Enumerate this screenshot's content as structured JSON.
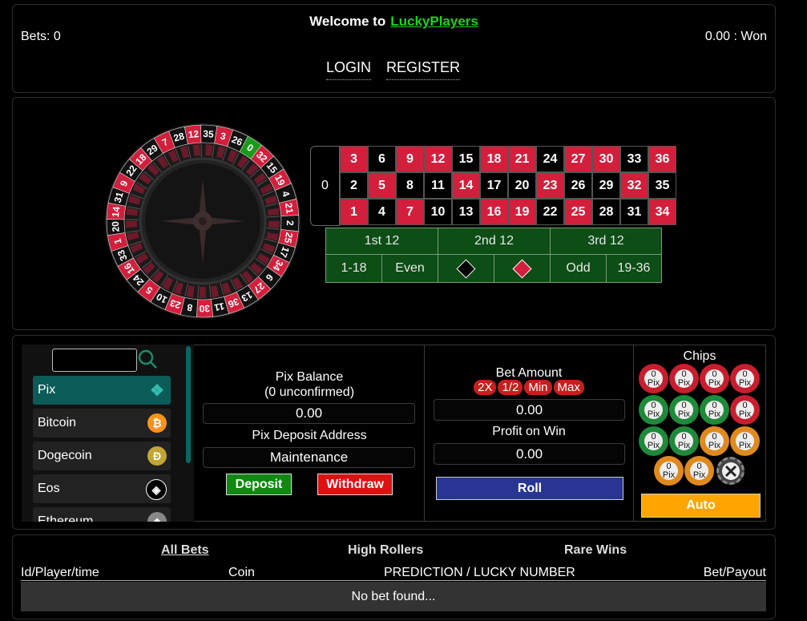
{
  "header": {
    "welcome": "Welcome to",
    "brand": "LuckyPlayers",
    "bets": "Bets: 0",
    "won": "0.00 : Won",
    "login": "LOGIN",
    "register": "REGISTER"
  },
  "table": {
    "zero": "0",
    "rows": [
      [
        "3",
        "6",
        "9",
        "12",
        "15",
        "18",
        "21",
        "24",
        "27",
        "30",
        "33",
        "36"
      ],
      [
        "2",
        "5",
        "8",
        "11",
        "14",
        "17",
        "20",
        "23",
        "26",
        "29",
        "32",
        "35"
      ],
      [
        "1",
        "4",
        "7",
        "10",
        "13",
        "16",
        "19",
        "22",
        "25",
        "28",
        "31",
        "34"
      ]
    ],
    "reds": [
      "1",
      "3",
      "5",
      "7",
      "9",
      "12",
      "14",
      "16",
      "18",
      "19",
      "21",
      "23",
      "25",
      "27",
      "30",
      "32",
      "34",
      "36"
    ],
    "dozens": [
      "1st 12",
      "2nd 12",
      "3rd 12"
    ],
    "outside": [
      "1-18",
      "Even",
      "",
      "",
      "Odd",
      "19-36"
    ]
  },
  "wheel": {
    "numbers": [
      "0",
      "32",
      "15",
      "19",
      "4",
      "21",
      "2",
      "25",
      "17",
      "34",
      "6",
      "27",
      "13",
      "36",
      "11",
      "30",
      "8",
      "23",
      "10",
      "5",
      "24",
      "16",
      "33",
      "1",
      "20",
      "14",
      "31",
      "9",
      "22",
      "18",
      "29",
      "7",
      "28",
      "12",
      "35",
      "3",
      "26"
    ]
  },
  "coins": {
    "search_value": "",
    "items": [
      {
        "label": "Pix",
        "icon": "pix-icon",
        "glyph": "❖",
        "color": "#32bcad"
      },
      {
        "label": "Bitcoin",
        "icon": "bitcoin-icon",
        "glyph": "₿",
        "color": "#f7931a"
      },
      {
        "label": "Dogecoin",
        "icon": "dogecoin-icon",
        "glyph": "Ð",
        "color": "#c2a633"
      },
      {
        "label": "Eos",
        "icon": "eos-icon",
        "glyph": "◈",
        "color": "#000000"
      },
      {
        "label": "Ethereum",
        "icon": "ethereum-icon",
        "glyph": "◆",
        "color": "#888888"
      }
    ]
  },
  "balance": {
    "title": "Pix Balance",
    "unconfirmed": "(0 unconfirmed)",
    "value": "0.00",
    "deposit_address_label": "Pix Deposit Address",
    "deposit_address": "Maintenance",
    "deposit": "Deposit",
    "withdraw": "Withdraw"
  },
  "bet": {
    "title": "Bet Amount",
    "x2": "2X",
    "half": "1/2",
    "min": "Min",
    "max": "Max",
    "amount": "0.00",
    "profit_label": "Profit on Win",
    "profit": "0.00",
    "roll": "Roll"
  },
  "chips": {
    "title": "Chips",
    "value": "0",
    "unit": "Pix",
    "auto": "Auto",
    "colors": [
      "r",
      "r",
      "r",
      "r",
      "g",
      "g",
      "g",
      "r",
      "g",
      "g",
      "o",
      "o",
      "o",
      "o"
    ]
  },
  "bets": {
    "tabs": [
      "All Bets",
      "High Rollers",
      "Rare Wins"
    ],
    "headers": [
      "Id/Player/time",
      "Coin",
      "PREDICTION / LUCKY NUMBER",
      "Bet/Payout"
    ],
    "empty": "No bet found..."
  },
  "colors": {
    "red": "#d31f3c",
    "green": "#0d4d16",
    "accent": "#1fd11f",
    "auto": "#ffa500",
    "roll": "#283593",
    "deposit": "#118811",
    "withdraw": "#e01010"
  }
}
